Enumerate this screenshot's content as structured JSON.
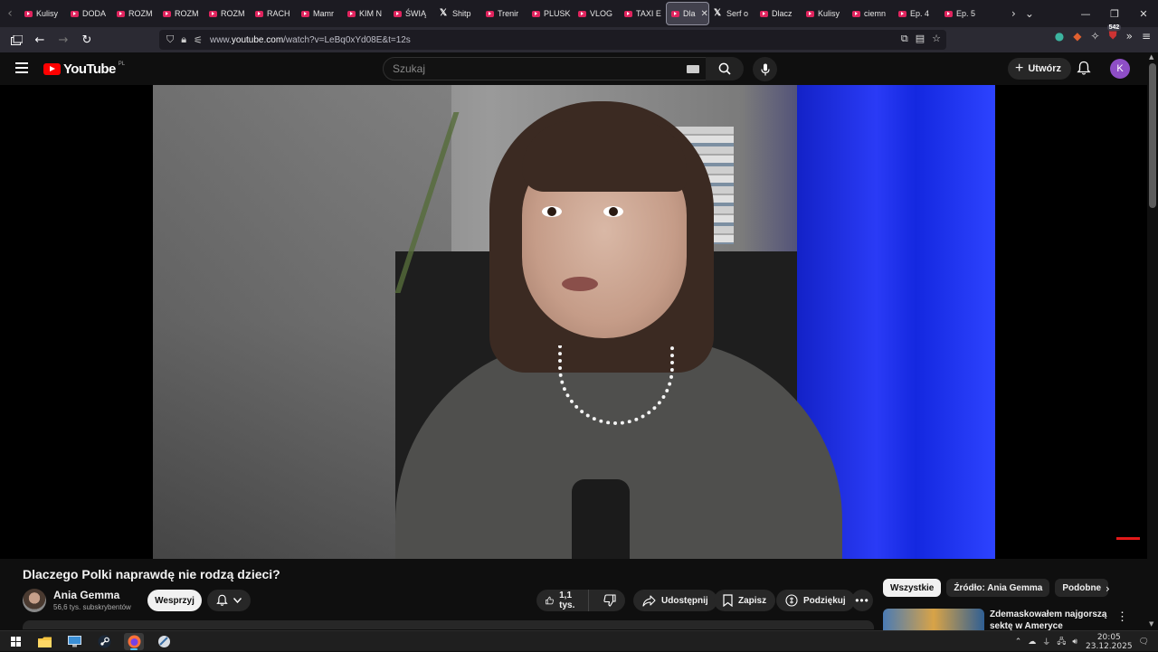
{
  "browser": {
    "tabs": [
      {
        "label": "Kulisy",
        "icon": "youtube-icon"
      },
      {
        "label": "DODA",
        "icon": "youtube-icon"
      },
      {
        "label": "ROZM",
        "icon": "youtube-icon"
      },
      {
        "label": "ROZM",
        "icon": "youtube-icon"
      },
      {
        "label": "ROZM",
        "icon": "youtube-icon"
      },
      {
        "label": "RACH",
        "icon": "youtube-icon"
      },
      {
        "label": "Mamr",
        "icon": "youtube-icon"
      },
      {
        "label": "KIM N",
        "icon": "youtube-icon"
      },
      {
        "label": "ŚWIĄ",
        "icon": "youtube-icon"
      },
      {
        "label": "Shitp",
        "icon": "x-icon"
      },
      {
        "label": "Trenir",
        "icon": "youtube-icon"
      },
      {
        "label": "PLUSK",
        "icon": "youtube-icon"
      },
      {
        "label": "VLOG",
        "icon": "youtube-icon"
      },
      {
        "label": "TAXI E",
        "icon": "youtube-icon"
      },
      {
        "label": "Dla",
        "icon": "youtube-icon",
        "active": true
      },
      {
        "label": "Serf o",
        "icon": "x-icon"
      },
      {
        "label": "Dlacz",
        "icon": "youtube-icon"
      },
      {
        "label": "Kulisy",
        "icon": "youtube-icon"
      },
      {
        "label": "ciemn",
        "icon": "youtube-icon"
      },
      {
        "label": "Ep. 4",
        "icon": "youtube-icon"
      },
      {
        "label": "Ep. 5",
        "icon": "youtube-icon"
      }
    ],
    "url_prefix": "www.",
    "url_domain": "youtube.com",
    "url_path": "/watch?v=LeBq0xYd08E&t=12s",
    "extension_badge": "542"
  },
  "youtube": {
    "logo_text": "YouTube",
    "country_code": "PL",
    "search_placeholder": "Szukaj",
    "create_label": "Utwórz",
    "avatar_letter": "K"
  },
  "video": {
    "title": "Dlaczego Polki naprawdę nie rodzą dzieci?",
    "channel_name": "Ania Gemma",
    "subscribers": "56,6 tys. subskrybentów",
    "support_label": "Wesprzyj",
    "likes": "1,1 tys.",
    "share_label": "Udostępnij",
    "save_label": "Zapisz",
    "thanks_label": "Podziękuj"
  },
  "sidebar": {
    "chips": [
      "Wszystkie",
      "Źródło: Ania Gemma",
      "Podobne"
    ],
    "active_chip": "Wszystkie",
    "recommendation_title": "Zdemaskowałem najgorszą sektę w Ameryce"
  },
  "taskbar": {
    "time": "20:05",
    "date": "23.12.2025"
  },
  "colors": {
    "youtube_red": "#ff0000",
    "background": "#0f0f0f",
    "accent_blue": "#4cc2ff",
    "avatar_purple": "#8e4ec6"
  }
}
